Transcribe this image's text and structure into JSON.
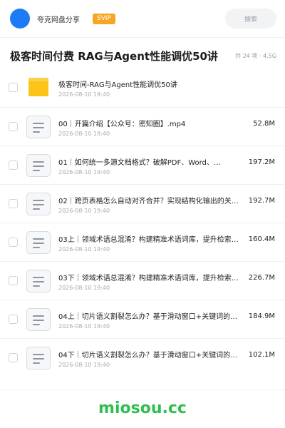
{
  "header": {
    "app_name": "夸克网盘分享",
    "badge": "SVIP",
    "search_placeholder": "搜索"
  },
  "page": {
    "title": "极客时间付费 RAG与Agent性能调优50讲",
    "meta": "共 24 项 · 4.5G"
  },
  "items": [
    {
      "type": "folder",
      "name": "极客时间-RAG与Agent性能调优50讲",
      "date": "2026-08-10 19:40",
      "size": ""
    },
    {
      "type": "file",
      "name": "00｜开篇介绍【公众号：密知圈】.mp4",
      "date": "2026-08-10 19:40",
      "size": "52.8M"
    },
    {
      "type": "file",
      "name": "01｜如何统一多源文档格式？破解PDF、Word、…",
      "date": "2026-08-10 19:40",
      "size": "197.2M"
    },
    {
      "type": "file",
      "name": "02｜跨页表格怎么自动对齐合并？实现结构化输出的关…",
      "date": "2026-08-10 19:40",
      "size": "192.7M"
    },
    {
      "type": "file",
      "name": "03上｜领域术语总混淆？构建精准术语词库，提升检索…",
      "date": "2026-08-10 19:40",
      "size": "160.4M"
    },
    {
      "type": "file",
      "name": "03下｜领域术语总混淆？构建精准术语词库，提升检索…",
      "date": "2026-08-10 19:40",
      "size": "226.7M"
    },
    {
      "type": "file",
      "name": "04上｜切片语义割裂怎么办？基于滑动窗口+关键词的…",
      "date": "2026-08-10 19:40",
      "size": "184.9M"
    },
    {
      "type": "file",
      "name": "04下｜切片语义割裂怎么办？基于滑动窗口+关键词的…",
      "date": "2026-08-10 19:40",
      "size": "102.1M"
    }
  ],
  "watermark": "miosou.cc",
  "colors": {
    "accent": "#1e7bf6",
    "badge": "#f5a623",
    "folder": "#fcc419",
    "watermark": "#2fbf4f"
  }
}
